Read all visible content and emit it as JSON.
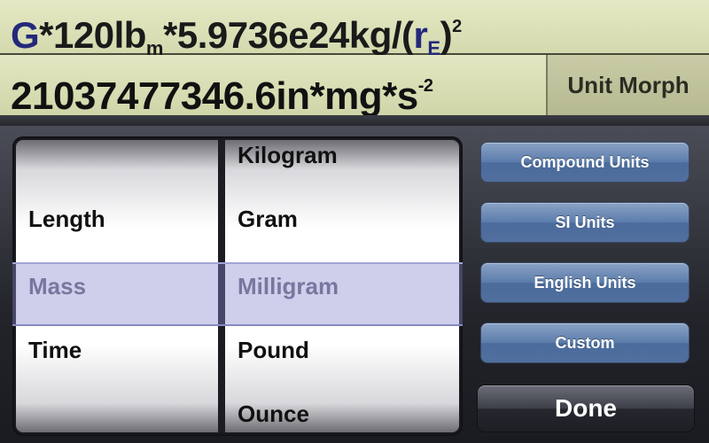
{
  "expression": {
    "g": "G",
    "part1": "*120lb",
    "sub_m": "m",
    "part2": "*5.9736e24kg/(",
    "r": "r",
    "sub_e": "E",
    "close": ")",
    "exp": "2"
  },
  "result": {
    "main": "21037477346.6in*mg*s",
    "exp": "-2"
  },
  "unit_morph_label": "Unit Morph",
  "picker": {
    "categories": [
      "Length",
      "Mass",
      "Time"
    ],
    "selected_category": "Mass",
    "units": [
      "Kilogram",
      "Gram",
      "Milligram",
      "Pound",
      "Ounce"
    ],
    "selected_unit": "Milligram"
  },
  "buttons": {
    "compound": "Compound Units",
    "si": "SI Units",
    "english": "English Units",
    "custom": "Custom",
    "done": "Done"
  },
  "colors": {
    "display_bg": "#dfe3bd",
    "expression_accent": "#23297a",
    "button_blue": "#5b7cab"
  }
}
